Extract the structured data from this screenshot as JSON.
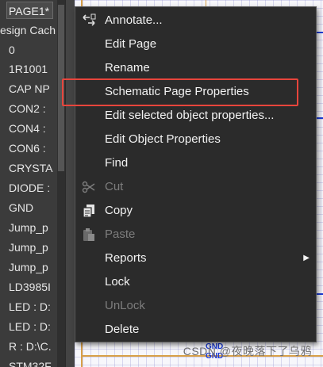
{
  "project_tree": {
    "page_tab": "PAGE1*",
    "cache_header": "esign Cach",
    "items": [
      "0",
      "1R1001",
      "CAP NP",
      "CON2 :",
      "CON4 :",
      "CON6 :",
      "CRYSTA",
      "DIODE :",
      "GND",
      "Jump_p",
      "Jump_p",
      "Jump_p",
      "LD3985I",
      "LED : D:",
      "LED : D:",
      "R : D:\\C.",
      "STM32F"
    ]
  },
  "canvas": {
    "net_labels": [
      "GND",
      "GND"
    ]
  },
  "context_menu": {
    "items": [
      {
        "label": "Annotate...",
        "icon": "annotate-icon",
        "enabled": true
      },
      {
        "label": "Edit Page",
        "enabled": true
      },
      {
        "label": "Rename",
        "enabled": true
      },
      {
        "label": "Schematic Page Properties",
        "enabled": true,
        "highlighted": true
      },
      {
        "label": "Edit selected object properties...",
        "enabled": true
      },
      {
        "label": "Edit Object Properties",
        "enabled": true
      },
      {
        "label": "Find",
        "enabled": true
      },
      {
        "label": "Cut",
        "icon": "scissors-icon",
        "enabled": false
      },
      {
        "label": "Copy",
        "icon": "copy-icon",
        "enabled": true
      },
      {
        "label": "Paste",
        "icon": "paste-icon",
        "enabled": false
      },
      {
        "label": "Reports",
        "enabled": true,
        "has_submenu": true
      },
      {
        "label": "Lock",
        "enabled": true
      },
      {
        "label": "UnLock",
        "enabled": false
      },
      {
        "label": "Delete",
        "enabled": true
      }
    ],
    "highlight_color": "#e8453c"
  },
  "watermark": "CSDN @夜晚落下了乌鸦"
}
